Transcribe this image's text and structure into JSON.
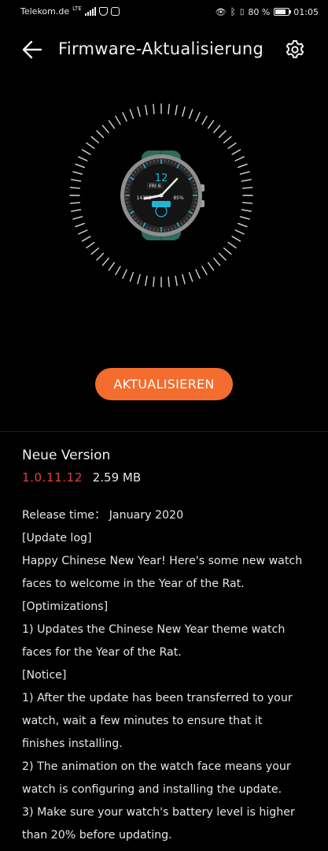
{
  "status_bar": {
    "carrier": "Telekom.de",
    "network": "LTE",
    "battery_text": "80 %",
    "battery_level": 0.8,
    "time": "01:05"
  },
  "header": {
    "title": "Firmware-Aktualisierung",
    "back_icon": "arrow-left-icon",
    "settings_icon": "gear-icon"
  },
  "watch": {
    "date_text": "FRI 6",
    "left_value": "14393",
    "right_value": "85%",
    "strap_color": "#2f6a5a",
    "accent_color": "#1fb6d6"
  },
  "update_button": {
    "label": "AKTUALISIEREN",
    "color": "#f46c2e"
  },
  "release": {
    "heading": "Neue Version",
    "version": "1.0.11.12",
    "size": "2.59 MB",
    "notes": [
      "Release time：  January 2020",
      "[Update log]",
      "Happy Chinese New Year! Here's some new watch",
      "faces to welcome in the Year of the Rat.",
      "[Optimizations]",
      "1) Updates the Chinese New Year theme watch",
      "faces for the Year of the Rat.",
      "[Notice]",
      "1) After the update has been transferred to your",
      "watch, wait a few minutes to ensure that it",
      "finishes installing.",
      "2) The animation on the watch face means your",
      "watch is configuring and installing the update.",
      "3) Make sure your watch's battery level is higher",
      "than 20% before updating."
    ]
  }
}
